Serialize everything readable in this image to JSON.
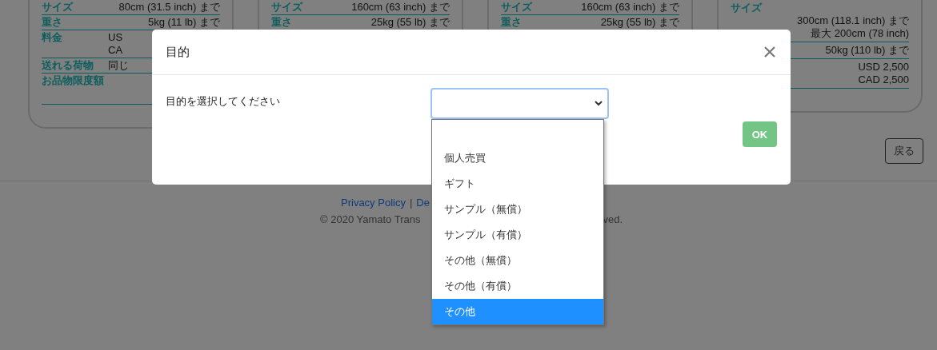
{
  "cards": [
    {
      "kind": "inline",
      "rows": [
        {
          "label": "サイズ",
          "values": [
            "80cm (31.5 inch) まで"
          ]
        },
        {
          "label": "重さ",
          "values": [
            "5kg (11 lb) まで"
          ]
        },
        {
          "label": "料金",
          "values": [
            "US",
            "CA"
          ]
        },
        {
          "label": "送れる荷物",
          "values": [
            "同じ"
          ]
        },
        {
          "label": "お品物限度額",
          "values": []
        }
      ]
    },
    {
      "kind": "inline",
      "rows": [
        {
          "label": "サイズ",
          "values": [
            "160cm (63 inch) まで"
          ]
        },
        {
          "label": "重さ",
          "values": [
            "25kg (55 lb) まで"
          ]
        }
      ]
    },
    {
      "kind": "inline",
      "rows": [
        {
          "label": "サイズ",
          "values": [
            "160cm (63 inch) まで"
          ]
        },
        {
          "label": "重さ",
          "values": [
            "25kg (55 lb) まで"
          ]
        }
      ]
    },
    {
      "kind": "stacked",
      "rows": [
        {
          "label": "サイズ",
          "values": [
            "300cm (118.1 inch) まで",
            "最大 200cm (78 inch)"
          ]
        },
        {
          "values": [
            "50kg (110 lb) まで"
          ]
        },
        {
          "values": [
            "USD 2,500",
            "CAD 2,500"
          ]
        }
      ]
    }
  ],
  "back_button": "戻る",
  "footer": {
    "links": [
      "Privacy Policy",
      "De"
    ],
    "separator": "|",
    "copyright": [
      "© 2020 Yamato Trans",
      "ved."
    ]
  },
  "modal": {
    "title": "目的",
    "label": "目的を選択してください",
    "ok_button": "OK",
    "options": [
      {
        "label": "個人売買",
        "selected": false
      },
      {
        "label": "ギフト",
        "selected": false
      },
      {
        "label": "サンプル（無償）",
        "selected": false
      },
      {
        "label": "サンプル（有償）",
        "selected": false
      },
      {
        "label": "その他（無償）",
        "selected": false
      },
      {
        "label": "その他（有償）",
        "selected": false
      },
      {
        "label": "その他",
        "selected": true
      }
    ]
  }
}
